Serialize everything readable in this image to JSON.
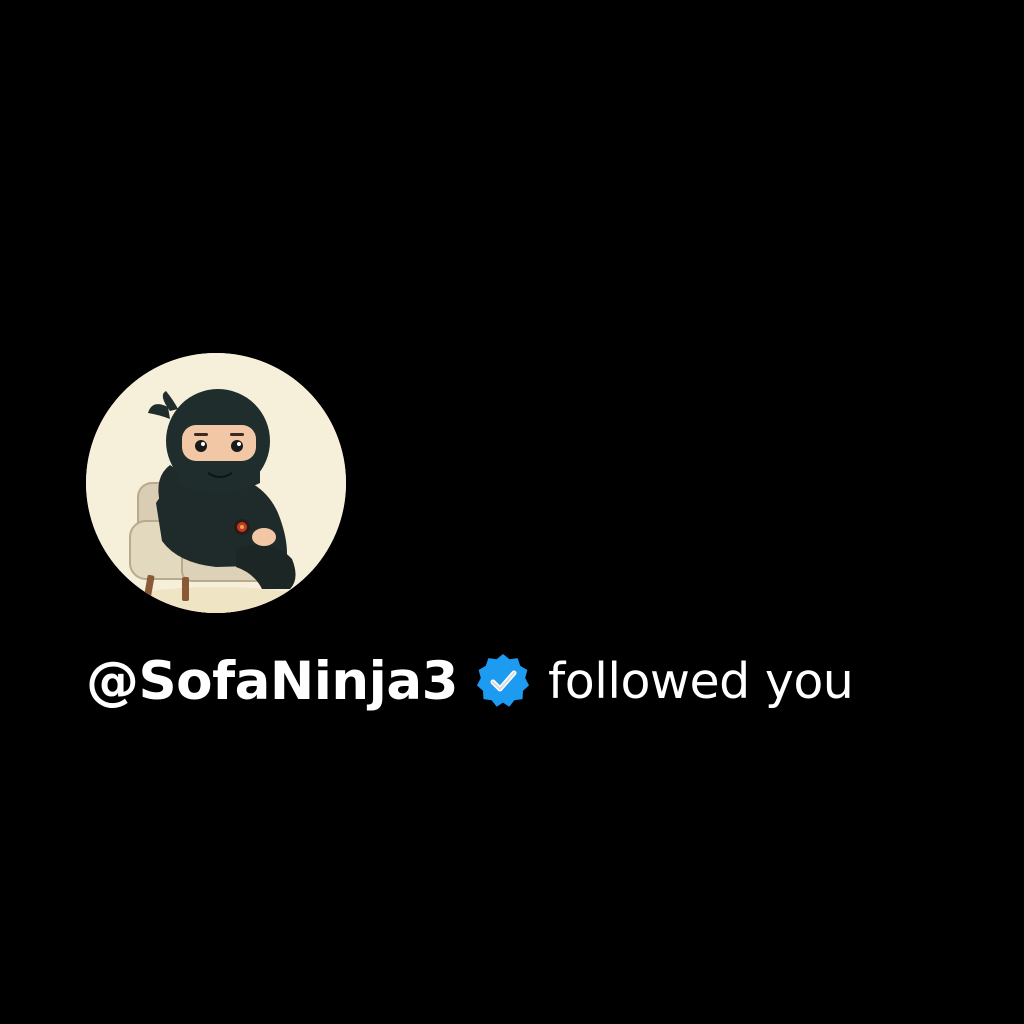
{
  "notification": {
    "username": "@SofaNinja3",
    "action_text": "followed you",
    "avatar_icon": "ninja-on-sofa-avatar",
    "verified_icon": "verified-badge-icon"
  },
  "colors": {
    "background": "#000000",
    "text": "#ffffff",
    "verified_badge": "#1d9bf0",
    "avatar_background": "#f6efd9"
  }
}
